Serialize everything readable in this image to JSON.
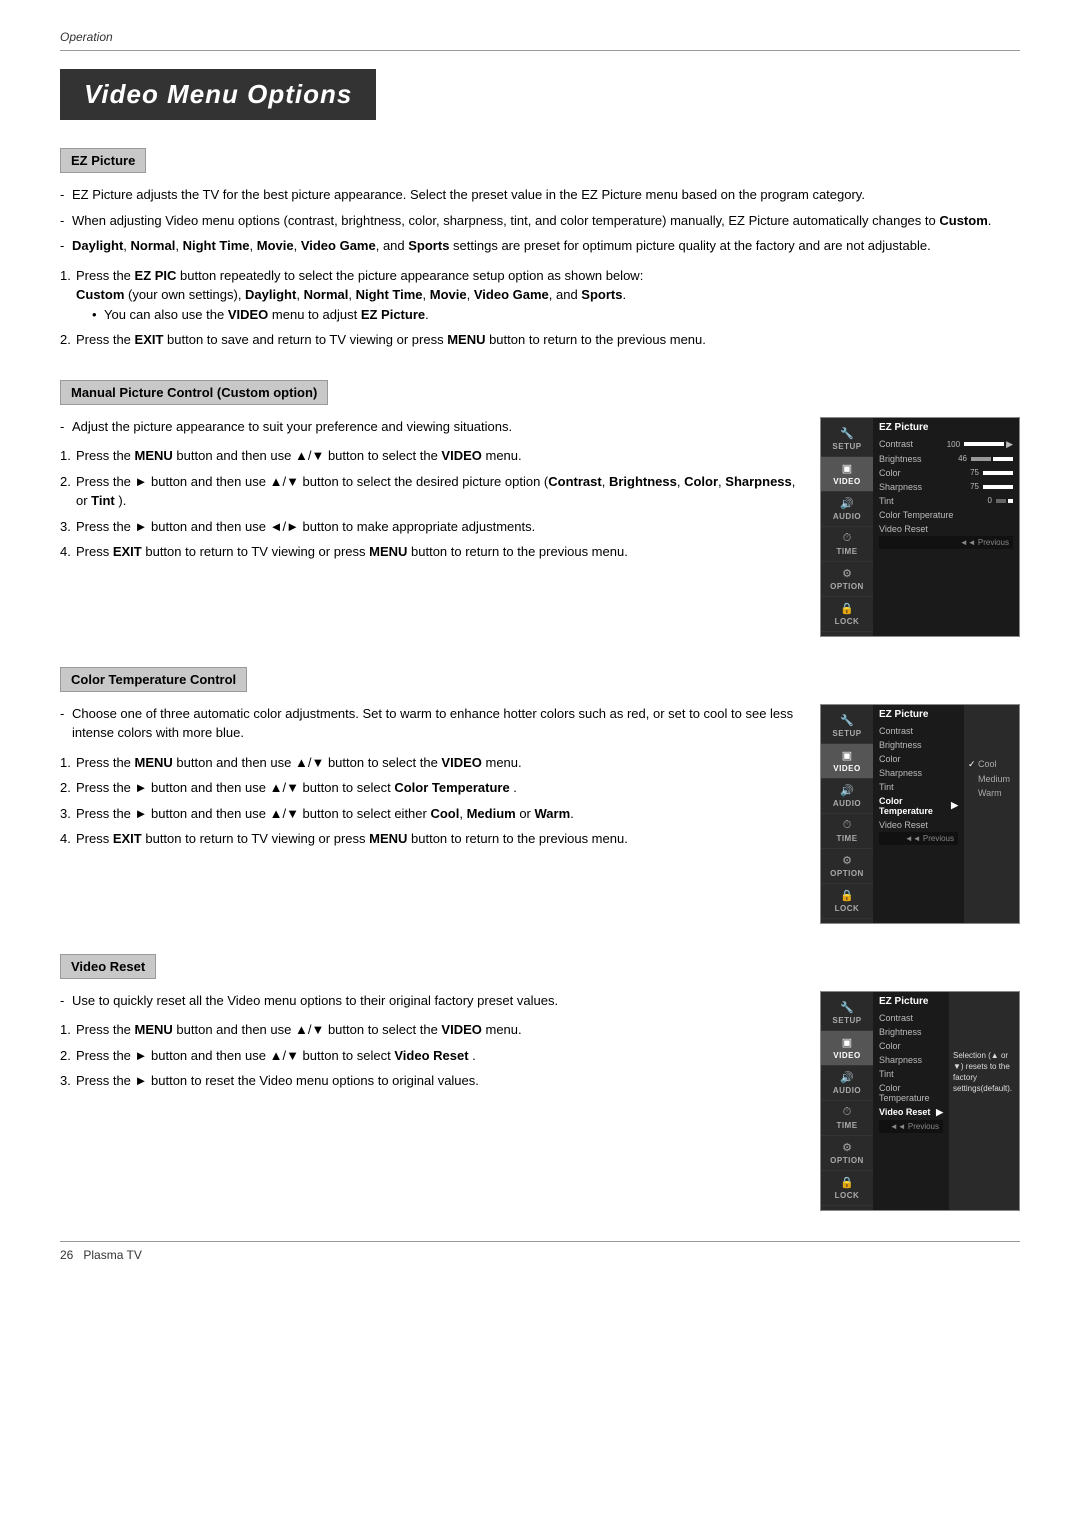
{
  "header": {
    "operation_label": "Operation",
    "title": "Video Menu Options"
  },
  "sections": {
    "ez_picture": {
      "header": "EZ Picture",
      "bullets": [
        "EZ Picture adjusts the TV for the best picture appearance. Select the preset value in the EZ Picture menu based on the program category.",
        "When adjusting Video menu options (contrast, brightness, color, sharpness, tint, and color temperature) manually, EZ Picture automatically changes to Custom.",
        "Daylight, Normal, Night Time, Movie, Video Game, and Sports settings are preset for optimum picture quality at the factory and are not adjustable."
      ],
      "steps": [
        {
          "num": "1.",
          "text": "Press the EZ PIC button repeatedly to select the picture appearance setup option as shown below: Custom (your own settings), Daylight, Normal, Night Time, Movie, Video Game, and Sports.",
          "sub": "• You can also use the VIDEO menu to adjust EZ Picture."
        },
        {
          "num": "2.",
          "text": "Press the EXIT button to save and return to TV viewing or press MENU button to return to the previous menu."
        }
      ]
    },
    "manual_picture": {
      "header": "Manual Picture Control (Custom option)",
      "bullets": [
        "Adjust the picture appearance to suit your preference and viewing situations."
      ],
      "steps": [
        {
          "num": "1.",
          "text": "Press the MENU button and then use ▲/▼ button to select the VIDEO menu."
        },
        {
          "num": "2.",
          "text": "Press the ► button and then use ▲/▼ button to select the desired picture option (Contrast, Brightness, Color, Sharpness, or Tint )."
        },
        {
          "num": "3.",
          "text": "Press the ► button and then use ◄/► button to make appropriate adjustments."
        },
        {
          "num": "4.",
          "text": "Press EXIT button to return to TV viewing or press MENU button to return to the previous menu."
        }
      ],
      "menu": {
        "title": "EZ Picture",
        "active_item": "VIDEO",
        "rows": [
          {
            "label": "Contrast",
            "value": "100",
            "bar": 100
          },
          {
            "label": "Brightness",
            "value": "46",
            "bar": 46
          },
          {
            "label": "Color",
            "value": "75",
            "bar": 75
          },
          {
            "label": "Sharpness",
            "value": "75",
            "bar": 75
          },
          {
            "label": "Tint",
            "value": "0",
            "bar": 50
          },
          {
            "label": "Color Temperature",
            "value": ""
          },
          {
            "label": "Video Reset",
            "value": ""
          }
        ],
        "footer": "◄◄ Previous"
      }
    },
    "color_temp": {
      "header": "Color Temperature Control",
      "bullets": [
        "Choose one of three automatic color adjustments. Set to warm to enhance hotter colors such as red, or set to cool to see less intense colors with more blue."
      ],
      "steps": [
        {
          "num": "1.",
          "text": "Press the MENU button and then use ▲/▼ button to select the VIDEO menu."
        },
        {
          "num": "2.",
          "text": "Press the ► button and then use ▲/▼ button to select Color Temperature ."
        },
        {
          "num": "3.",
          "text": "Press the ► button and then use ▲/▼ button to select either Cool, Medium or Warm."
        },
        {
          "num": "4.",
          "text": "Press EXIT button to return to TV viewing or press MENU button to return to the previous menu."
        }
      ],
      "menu": {
        "title": "EZ Picture",
        "active_item": "VIDEO",
        "rows": [
          {
            "label": "Contrast",
            "value": ""
          },
          {
            "label": "Brightness",
            "value": ""
          },
          {
            "label": "Color",
            "value": ""
          },
          {
            "label": "Sharpness",
            "value": ""
          },
          {
            "label": "Tint",
            "value": ""
          },
          {
            "label": "Color Temperature",
            "value": "",
            "selected": true
          },
          {
            "label": "Video Reset",
            "value": ""
          }
        ],
        "submenu": [
          "Cool",
          "Medium",
          "Warm"
        ],
        "checked": "Cool",
        "footer": "◄◄ Previous"
      }
    },
    "video_reset": {
      "header": "Video Reset",
      "bullets": [
        "Use to quickly reset all the Video menu options to their original factory preset values."
      ],
      "steps": [
        {
          "num": "1.",
          "text": "Press the MENU button and then use ▲/▼ button to select the VIDEO menu."
        },
        {
          "num": "2.",
          "text": "Press the ► button and then use ▲/▼ button to select Video Reset ."
        },
        {
          "num": "3.",
          "text": "Press the ► button to reset the Video menu options to original values."
        }
      ],
      "menu": {
        "title": "EZ Picture",
        "active_item": "VIDEO",
        "rows": [
          {
            "label": "Contrast",
            "value": ""
          },
          {
            "label": "Brightness",
            "value": ""
          },
          {
            "label": "Color",
            "value": ""
          },
          {
            "label": "Sharpness",
            "value": ""
          },
          {
            "label": "Tint",
            "value": ""
          },
          {
            "label": "Color Temperature",
            "value": ""
          },
          {
            "label": "Video Reset",
            "value": "",
            "selected": true
          }
        ],
        "submenu_text": "Selection (▲ or ▼) resets to the factory settings(default).",
        "footer": "◄◄ Previous"
      }
    }
  },
  "footer": {
    "page_number": "26",
    "product": "Plasma TV"
  }
}
